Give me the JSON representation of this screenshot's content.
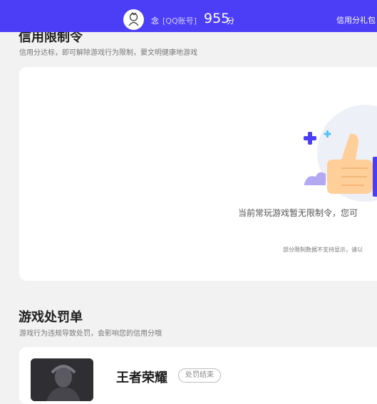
{
  "header": {
    "nickname_icon": "念",
    "account_label": "[QQ账号]",
    "score": "955",
    "score_unit": "分",
    "gift_link": "信用分礼包"
  },
  "restriction_section": {
    "title": "信用限制令",
    "subtitle": "信用分达标，即可解除游戏行为限制，要文明健康地游戏",
    "empty_message": "当前常玩游戏暂无限制令，您可",
    "empty_note": "部分限制数据不支持显示，请以"
  },
  "penalty_section": {
    "title": "游戏处罚单",
    "subtitle": "游戏行为违规导致处罚，会影响您的信用分哦",
    "items": [
      {
        "game": "王者荣耀",
        "status": "处罚结束"
      }
    ]
  },
  "colors": {
    "header_bg": "#4b3ef6",
    "page_bg": "#f2f2f2",
    "card_bg": "#ffffff"
  },
  "icons": {
    "avatar": "cartoon-avatar",
    "illustration": "thumbs-up-illustration"
  }
}
